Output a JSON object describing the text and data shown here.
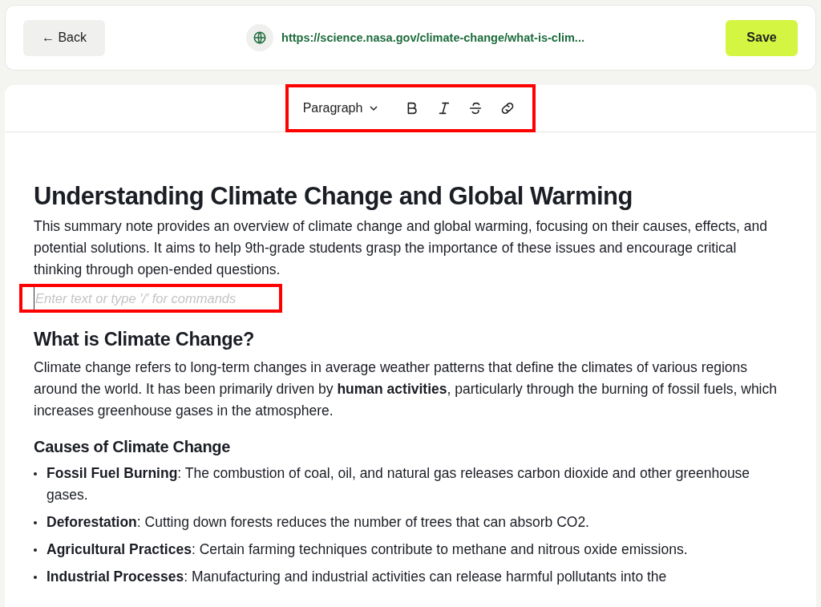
{
  "top_bar": {
    "back_button": "← Back",
    "url": "https://science.nasa.gov/climate-change/what-is-clim...",
    "save_button": "Save"
  },
  "toolbar": {
    "highlighted": true,
    "block_style": "Paragraph",
    "buttons": [
      {
        "kind": "bold"
      },
      {
        "kind": "italic"
      },
      {
        "kind": "strike"
      },
      {
        "kind": "link"
      }
    ]
  },
  "blocks": [
    {
      "kind": "heading1",
      "text": "Understanding Climate Change and Global Warming"
    },
    {
      "kind": "paragraph",
      "text": "This summary note provides an overview of climate change and global warming, focusing on their causes, effects, and potential solutions. It aims to help 9th-grade students grasp the importance of these issues and encourage critical thinking through open-ended questions."
    },
    {
      "kind": "placeholder",
      "placeholder": "Enter text or type '/' for commands",
      "highlighted": true
    },
    {
      "kind": "heading2",
      "text": "What is Climate Change?"
    },
    {
      "kind": "paragraph",
      "text": "Climate change refers to long-term changes in average weather patterns that define the climates of various regions around the world. It has been primarily driven by **human activities**, particularly through the burning of fossil fuels, which increases greenhouse gases in the atmosphere."
    },
    {
      "kind": "heading3",
      "text": "Causes of Climate Change"
    },
    {
      "kind": "bullet",
      "text": "**Fossil Fuel Burning**: The combustion of coal, oil, and natural gas releases carbon dioxide and other greenhouse gases."
    },
    {
      "kind": "bullet",
      "text": "**Deforestation**: Cutting down forests reduces the number of trees that can absorb CO2."
    },
    {
      "kind": "bullet",
      "text": "**Agricultural Practices**: Certain farming techniques contribute to methane and nitrous oxide emissions."
    },
    {
      "kind": "bullet",
      "text": "**Industrial Processes**: Manufacturing and industrial activities can release harmful pollutants into the"
    }
  ]
}
